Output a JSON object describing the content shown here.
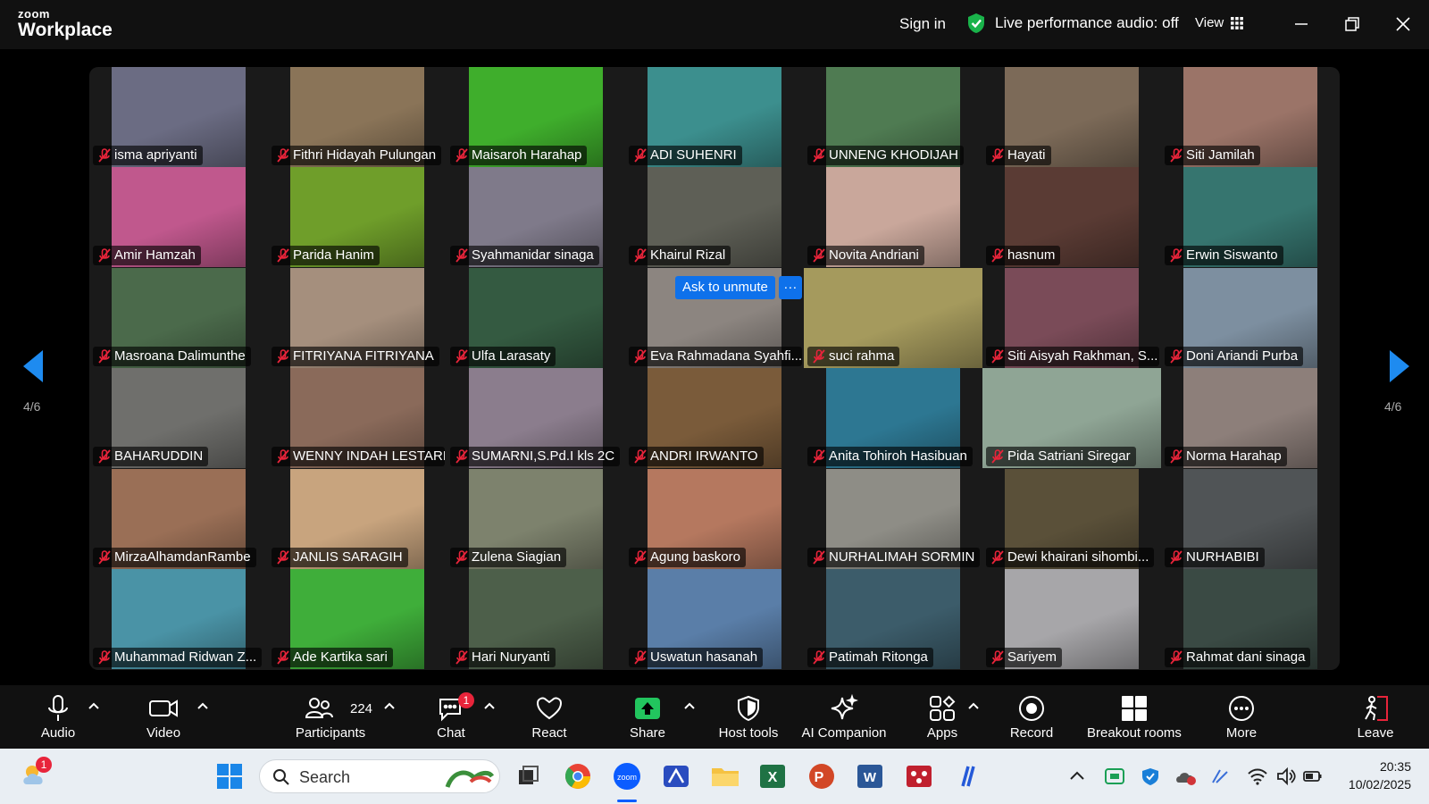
{
  "titlebar": {
    "brand_small": "zoom",
    "brand_big": "Workplace",
    "sign_in": "Sign in",
    "live_audio": "Live performance audio: off",
    "view": "View"
  },
  "gallery": {
    "page_left": "4/6",
    "page_right": "4/6",
    "ask_to_unmute": "Ask to unmute",
    "ask_more": "···",
    "participants": [
      {
        "name": "isma apriyanti",
        "bg": "#6b6c83"
      },
      {
        "name": "Fithri Hidayah Pulungan",
        "bg": "#8a7458"
      },
      {
        "name": "Maisaroh Harahap",
        "bg": "#3fae2c"
      },
      {
        "name": "ADI SUHENRI",
        "bg": "#3c8f8e"
      },
      {
        "name": "UNNENG KHODIJAH",
        "bg": "#4f7b52"
      },
      {
        "name": "Hayati",
        "bg": "#7c6a58"
      },
      {
        "name": "Siti Jamilah",
        "bg": "#9b7468"
      },
      {
        "name": "Amir Hamzah",
        "bg": "#c0588d"
      },
      {
        "name": "Parida Hanim",
        "bg": "#6f9e2a"
      },
      {
        "name": "Syahmanidar sinaga",
        "bg": "#7f7a8a"
      },
      {
        "name": "Khairul Rizal",
        "bg": "#5e5f56"
      },
      {
        "name": "Novita Andriani",
        "bg": "#c9a79b"
      },
      {
        "name": "hasnum",
        "bg": "#5a3b34"
      },
      {
        "name": "Erwin Siswanto",
        "bg": "#36756f"
      },
      {
        "name": "Masroana Dalimunthe",
        "bg": "#4b6a4b"
      },
      {
        "name": "FITRIYANA FITRIYANA",
        "bg": "#a58f7d"
      },
      {
        "name": "Ulfa Larasaty",
        "bg": "#345a41"
      },
      {
        "name": "Eva Rahmadana Syahfi...",
        "bg": "#8c8580"
      },
      {
        "name": "suci rahma",
        "bg": "#a59a5d"
      },
      {
        "name": "Siti Aisyah Rakhman, S...",
        "bg": "#7a4b58"
      },
      {
        "name": "Doni Ariandi Purba",
        "bg": "#7d8fa0"
      },
      {
        "name": "BAHARUDDIN",
        "bg": "#6f6f6c"
      },
      {
        "name": "WENNY INDAH LESTARI",
        "bg": "#8a6a5a"
      },
      {
        "name": "SUMARNI,S.Pd.I  kls 2C",
        "bg": "#8b7d8d"
      },
      {
        "name": "ANDRI IRWANTO",
        "bg": "#7a5b3a"
      },
      {
        "name": "Anita Tohiroh Hasibuan",
        "bg": "#2d7792"
      },
      {
        "name": "Pida Satriani Siregar",
        "bg": "#8fa595"
      },
      {
        "name": "Norma Harahap",
        "bg": "#8d7f7a"
      },
      {
        "name": "MirzaAlhamdanRambe",
        "bg": "#9a6f56"
      },
      {
        "name": "JANLIS SARAGIH",
        "bg": "#c8a47e"
      },
      {
        "name": "Zulena Siagian",
        "bg": "#7d826d"
      },
      {
        "name": "Agung baskoro",
        "bg": "#b5785f"
      },
      {
        "name": "NURHALIMAH SORMIN",
        "bg": "#8e8d86"
      },
      {
        "name": "Dewi khairani sihombi...",
        "bg": "#5a5039"
      },
      {
        "name": "NURHABIBI",
        "bg": "#505456"
      },
      {
        "name": "Muhammad Ridwan Z...",
        "bg": "#4a93a6"
      },
      {
        "name": "Ade  Kartika sari",
        "bg": "#3fae3a"
      },
      {
        "name": "Hari Nuryanti",
        "bg": "#4d5f4a"
      },
      {
        "name": "Uswatun hasanah",
        "bg": "#5a7ea8"
      },
      {
        "name": "Patimah Ritonga",
        "bg": "#3c5c6a"
      },
      {
        "name": "Sariyem",
        "bg": "#a7a6a9"
      },
      {
        "name": "Rahmat dani sinaga",
        "bg": "#3a4a44"
      }
    ]
  },
  "toolbar": {
    "audio": "Audio",
    "video": "Video",
    "participants": "Participants",
    "participant_count": "224",
    "chat": "Chat",
    "chat_badge": "1",
    "react": "React",
    "share": "Share",
    "host_tools": "Host tools",
    "ai_companion": "AI Companion",
    "apps": "Apps",
    "record": "Record",
    "breakout_rooms": "Breakout rooms",
    "more": "More",
    "leave": "Leave"
  },
  "taskbar": {
    "weather_badge": "1",
    "search_placeholder": "Search",
    "time": "20:35",
    "date": "10/02/2025"
  },
  "colors": {
    "accent_blue": "#0e71eb",
    "share_green": "#22c55e",
    "badge_red": "#e8243a",
    "live_green": "#19b34a"
  }
}
